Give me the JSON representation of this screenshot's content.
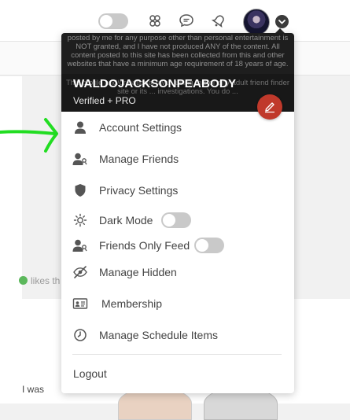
{
  "header": {
    "dark_mode_toggle_on": false
  },
  "background": {
    "likes_text": "likes th",
    "post_snippet": "I was"
  },
  "profile": {
    "disclaimer_top": "posted by me for any purpose other than personal entertainment is NOT granted, and I have not produced ANY of the content. All content posted to this site has been collected from this and other websites that have a minimum age requirement of 18 years of age.",
    "disclaimer_bottom": "This profile and/or national law... using this or any adult friend finder site or its ... investigations. You do ...",
    "username": "WALDOJACKSONPEABODY",
    "status": "Verified + PRO"
  },
  "menu": {
    "items": [
      {
        "label": "Account Settings",
        "icon": "person-icon"
      },
      {
        "label": "Manage Friends",
        "icon": "friends-icon"
      },
      {
        "label": "Privacy Settings",
        "icon": "shield-icon"
      },
      {
        "label": "Dark Mode",
        "icon": "sun-icon",
        "toggle": false
      },
      {
        "label": "Friends Only Feed",
        "icon": "friends-icon",
        "toggle": false
      },
      {
        "label": "Manage Hidden",
        "icon": "eye-slash-icon"
      },
      {
        "label": "Membership",
        "icon": "id-card-icon"
      },
      {
        "label": "Manage Schedule Items",
        "icon": "clock-icon"
      }
    ],
    "logout_label": "Logout"
  },
  "colors": {
    "arrow": "#22dd22",
    "edit_button": "#c0392b",
    "banner": "#1e1e1e"
  }
}
